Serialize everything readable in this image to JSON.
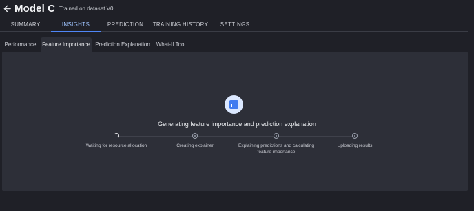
{
  "header": {
    "back_icon": "arrow-left-icon",
    "title": "Model C",
    "subtitle": "Trained on dataset V0"
  },
  "tabs": [
    {
      "label": "SUMMARY",
      "active": false
    },
    {
      "label": "INSIGHTS",
      "active": true
    },
    {
      "label": "PREDICTION",
      "active": false
    },
    {
      "label": "TRAINING HISTORY",
      "active": false
    },
    {
      "label": "SETTINGS",
      "active": false
    }
  ],
  "subtabs": [
    {
      "label": "Performance",
      "active": false
    },
    {
      "label": "Feature Importance",
      "active": true
    },
    {
      "label": "Prediction Explanation",
      "active": false
    },
    {
      "label": "What-If Tool",
      "active": false
    }
  ],
  "status": {
    "icon": "bar-chart-icon",
    "heading": "Generating feature importance and prediction explanation"
  },
  "steps": [
    {
      "label": "Waiting for resource allocation",
      "state": "loading"
    },
    {
      "label": "Creating explainer",
      "state": "pending"
    },
    {
      "label": "Explaining predictions and calculating feature importance",
      "state": "pending"
    },
    {
      "label": "Uploading results",
      "state": "pending"
    }
  ],
  "colors": {
    "background": "#1f2027",
    "panel": "#2d2f38",
    "accent": "#4f86f7",
    "active_tab_text": "#9fc4ff"
  }
}
